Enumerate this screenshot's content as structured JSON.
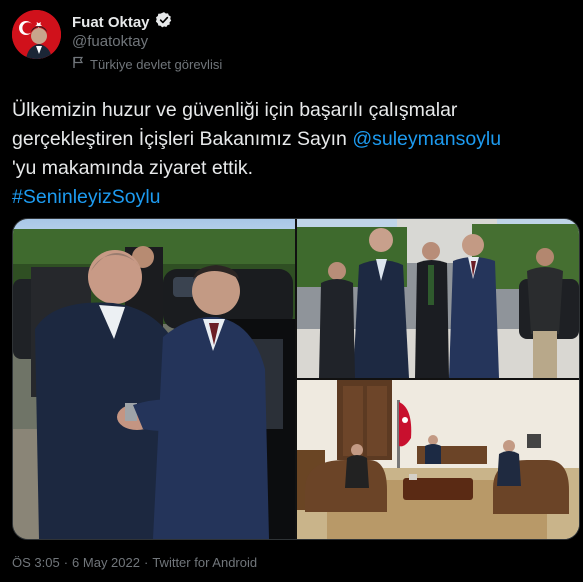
{
  "author": {
    "display_name": "Fuat Oktay",
    "handle": "@fuatoktay",
    "verified_icon": "verified-badge-icon",
    "label": "Türkiye devlet görevlisi",
    "label_icon": "flag-icon"
  },
  "tweet": {
    "text_line1": "Ülkemizin huzur ve güvenliği için başarılı çalışmalar",
    "text_line2_prefix": "gerçekleştiren İçişleri Bakanımız Sayın ",
    "mention": "@suleymansoylu",
    "text_line3": "'yu makamında ziyaret ettik.",
    "hashtag": "#SeninleyizSoylu"
  },
  "media": {
    "photo_count": 3,
    "photos": [
      "handshake-photo",
      "walking-photo",
      "office-meeting-photo"
    ]
  },
  "meta": {
    "time": "ÖS 3:05",
    "separator": "·",
    "date": "6 May 2022",
    "source": "Twitter for Android"
  },
  "colors": {
    "background": "#000000",
    "text": "#e7e9ea",
    "secondary": "#71767b",
    "link": "#1d9bf0"
  }
}
